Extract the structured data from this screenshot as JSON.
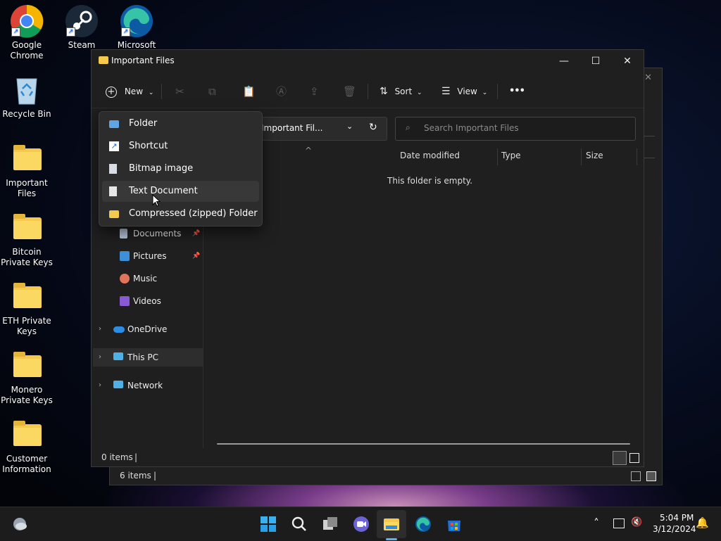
{
  "desktop": {
    "icons": [
      {
        "label": "Google Chrome"
      },
      {
        "label": "Steam"
      },
      {
        "label": "Microsoft"
      },
      {
        "label": "Recycle Bin"
      },
      {
        "label": "Important Files"
      },
      {
        "label": "Bitcoin Private Keys"
      },
      {
        "label": "ETH Private Keys"
      },
      {
        "label": "Monero Private Keys"
      },
      {
        "label": "Customer Information"
      }
    ]
  },
  "back_window": {
    "status_count": "6 items"
  },
  "window": {
    "title": "Important Files",
    "controls": {
      "minimize": "—",
      "maximize": "☐",
      "close": "✕"
    },
    "toolbar": {
      "new": "New",
      "sort": "Sort",
      "view": "View",
      "more": "•••"
    },
    "address": "Important Fil...",
    "search_placeholder": "Search Important Files",
    "columns": {
      "name_sort": "^",
      "date": "Date modified",
      "type": "Type",
      "size": "Size"
    },
    "empty_message": "This folder is empty.",
    "nav": [
      {
        "label": "Documents",
        "pinned": true,
        "icon": "documents-icon"
      },
      {
        "label": "Pictures",
        "pinned": true,
        "icon": "pictures-icon"
      },
      {
        "label": "Music",
        "pinned": false,
        "icon": "music-icon"
      },
      {
        "label": "Videos",
        "pinned": false,
        "icon": "videos-icon"
      },
      {
        "label": "OneDrive",
        "expandable": true,
        "icon": "onedrive-icon"
      },
      {
        "label": "This PC",
        "expandable": true,
        "selected": true,
        "icon": "this-pc-icon"
      },
      {
        "label": "Network",
        "expandable": true,
        "icon": "network-icon"
      }
    ],
    "status_count": "0 items"
  },
  "new_menu": {
    "items": [
      {
        "label": "Folder",
        "icon": "new-folder-icon"
      },
      {
        "label": "Shortcut",
        "icon": "shortcut-icon"
      },
      {
        "label": "Bitmap image",
        "icon": "bitmap-icon"
      },
      {
        "label": "Text Document",
        "icon": "text-document-icon",
        "hovered": true
      },
      {
        "label": "Compressed (zipped) Folder",
        "icon": "zip-folder-icon"
      }
    ]
  },
  "taskbar": {
    "time": "5:04 PM",
    "date": "3/12/2024"
  },
  "colors": {
    "folder": "#f5c94c",
    "accent": "#0078d4",
    "selected_nav": "#2d2d2d"
  }
}
